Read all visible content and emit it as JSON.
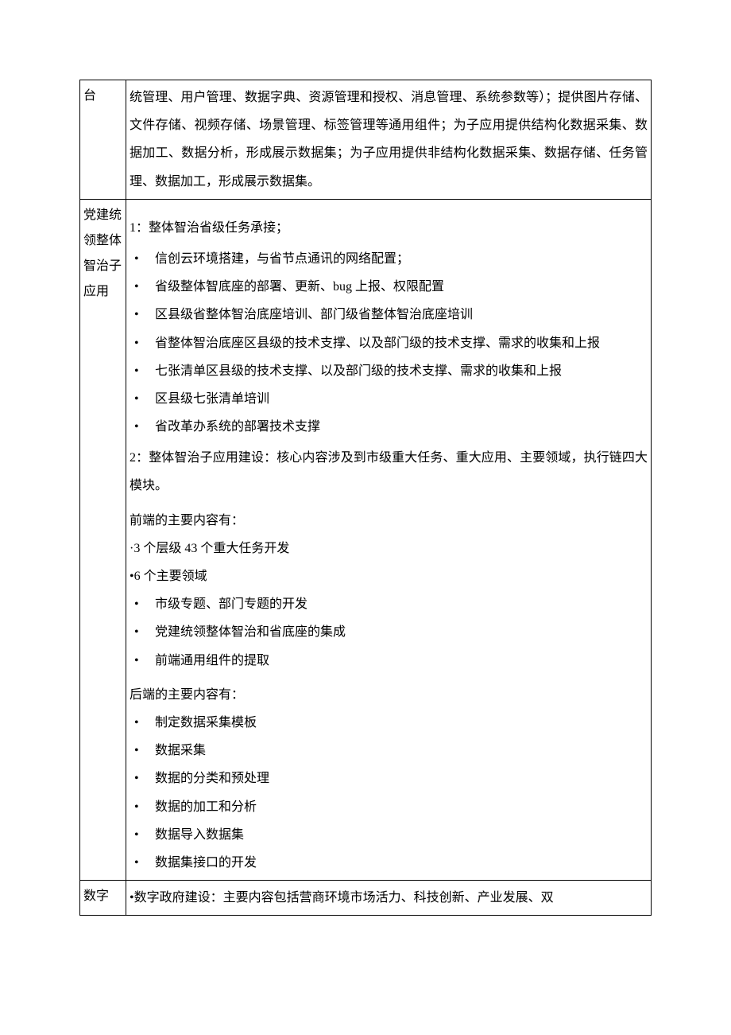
{
  "row1": {
    "label": "台",
    "content": "统管理、用户管理、数据字典、资源管理和授权、消息管理、系统参数等）；提供图片存储、文件存储、视频存储、场景管理、标签管理等通用组件；为子应用提供结构化数据采集、数据加工、数据分析，形成展示数据集；为子应用提供非结构化数据采集、数据存储、任务管理、数据加工，形成展示数据集。"
  },
  "row2": {
    "label": "党建统领整体智治子应用",
    "section1_title": "1：整体智治省级任务承接；",
    "section1_items": [
      "信创云环境搭建，与省节点通讯的网络配置；",
      "省级整体智底座的部署、更新、bug 上报、权限配置",
      "区县级省整体智治底座培训、部门级省整体智治底座培训",
      "省整体智治底座区县级的技术支撑、以及部门级的技术支撑、需求的收集和上报",
      "七张清单区县级的技术支撑、以及部门级的技术支撑、需求的收集和上报",
      "区县级七张清单培训",
      "省改革办系统的部署技术支撑"
    ],
    "section2_title": "2：整体智治子应用建设：核心内容涉及到市级重大任务、重大应用、主要领域，执行链四大模块。",
    "frontend_title": "前端的主要内容有：",
    "frontend_line1": "·3 个层级 43 个重大任务开发",
    "frontend_line2": "•6 个主要领域",
    "frontend_items": [
      "市级专题、部门专题的开发",
      "党建统领整体智治和省底座的集成",
      "前端通用组件的提取"
    ],
    "backend_title": "后端的主要内容有：",
    "backend_items": [
      "制定数据采集模板",
      "数据采集",
      "数据的分类和预处理",
      "数据的加工和分析",
      "数据导入数据集",
      "数据集接口的开发"
    ]
  },
  "row3": {
    "label": "数字",
    "content": "•数字政府建设：主要内容包括营商环境市场活力、科技创新、产业发展、双"
  }
}
